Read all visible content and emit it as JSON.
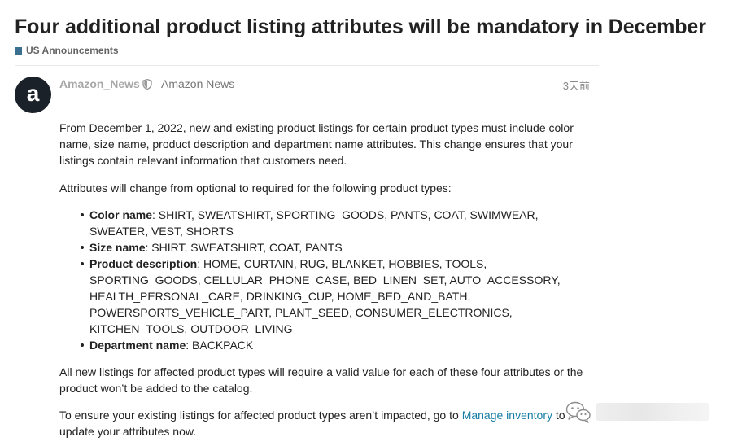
{
  "topic": {
    "title": "Four additional product listing attributes will be mandatory in December",
    "category": {
      "label": "US Announcements",
      "color": "#3b6f8f"
    }
  },
  "post": {
    "avatar_letter": "a",
    "username": "Amazon_News",
    "user_badge_icon": "shield-icon",
    "full_name": "Amazon News",
    "date": "3天前",
    "paragraph_1": "From December 1, 2022, new and existing product listings for certain product types must include color name, size name, product description and department name attributes. This change ensures that your listings contain relevant information that customers need.",
    "paragraph_2": "Attributes will change from optional to required for the following product types:",
    "attributes": [
      {
        "name": "Color name",
        "values": ": SHIRT, SWEATSHIRT, SPORTING_GOODS, PANTS, COAT, SWIMWEAR, SWEATER, VEST, SHORTS"
      },
      {
        "name": "Size name",
        "values": ": SHIRT, SWEATSHIRT, COAT, PANTS"
      },
      {
        "name": "Product description",
        "values": ": HOME, CURTAIN, RUG, BLANKET, HOBBIES, TOOLS, SPORTING_GOODS, CELLULAR_PHONE_CASE, BED_LINEN_SET, AUTO_ACCESSORY, HEALTH_PERSONAL_CARE, DRINKING_CUP, HOME_BED_AND_BATH, POWERSPORTS_VEHICLE_PART, PLANT_SEED, CONSUMER_ELECTRONICS, KITCHEN_TOOLS, OUTDOOR_LIVING"
      },
      {
        "name": "Department name",
        "values": ": BACKPACK"
      }
    ],
    "paragraph_3": "All new listings for affected product types will require a valid value for each of these four attributes or the product won’t be added to the catalog.",
    "paragraph_4_before": "To ensure your existing listings for affected product types aren’t impacted, go to ",
    "paragraph_4_link": "Manage inventory",
    "paragraph_4_after": " to update your attributes now."
  },
  "watermark": {
    "icon": "wechat-icon"
  }
}
